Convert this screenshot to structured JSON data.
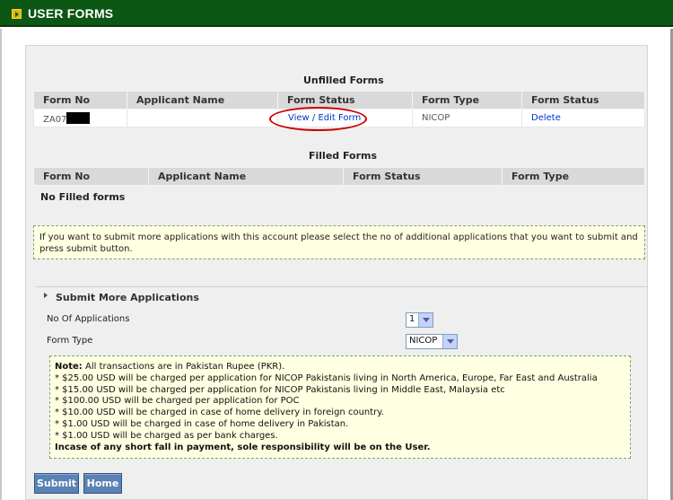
{
  "header": {
    "title": "USER FORMS"
  },
  "unfilled": {
    "caption": "Unfilled Forms",
    "columns": [
      "Form No",
      "Applicant Name",
      "Form Status",
      "Form Type",
      "Form Status"
    ],
    "rows": [
      {
        "form_no": "ZA07",
        "applicant": "",
        "status_link": "View / Edit Form",
        "type": "NICOP",
        "action_link": "Delete"
      }
    ]
  },
  "filled": {
    "caption": "Filled Forms",
    "columns": [
      "Form No",
      "Applicant Name",
      "Form Status",
      "Form Type"
    ],
    "empty_text": "No Filled forms"
  },
  "info_text": "If you want to submit more applications with this account please select the no of additional applications that you want to submit and press submit button.",
  "submit_more": {
    "heading": "Submit More Applications",
    "applications_label": "No Of Applications",
    "applications_value": "1",
    "form_type_label": "Form Type",
    "form_type_value": "NICOP"
  },
  "note": {
    "intro_label": "Note:",
    "intro_text": " All transactions are in Pakistan Rupee (PKR).",
    "lines": [
      "* $25.00 USD will be charged per application for NICOP Pakistanis living in North America, Europe, Far East and Australia",
      "* $15.00 USD will be charged per application for NICOP Pakistanis living in Middle East, Malaysia etc",
      "* $100.00 USD will be charged per application for POC",
      "* $10.00 USD will be charged in case of home delivery in foreign country.",
      "* $1.00 USD will be charged in case of home delivery in Pakistan.",
      "* $1.00 USD will be charged as per bank charges."
    ],
    "closing": "Incase of any short fall in payment, sole responsibility will be on the User."
  },
  "buttons": {
    "submit": "Submit",
    "home": "Home"
  },
  "colors": {
    "header_bg": "#0c5714",
    "button_bg": "#5b82b4",
    "link": "#0033cc",
    "highlight_oval": "#cc0000"
  }
}
